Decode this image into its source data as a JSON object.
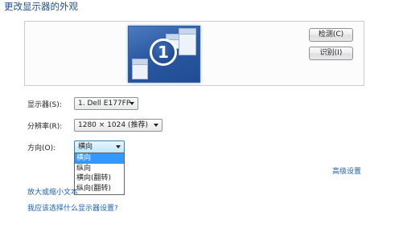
{
  "page": {
    "title": "更改显示器的外观"
  },
  "preview": {
    "monitor_number": "1",
    "detect_label": "检测(C)",
    "identify_label": "识别(I)"
  },
  "fields": {
    "display_label": "显示器(S):",
    "display_value": "1. Dell E177FP",
    "resolution_label": "分辨率(R):",
    "resolution_value": "1280 × 1024 (推荐)",
    "orientation_label": "方向(O):",
    "orientation_value": "横向"
  },
  "orientation_options": [
    {
      "label": "横向",
      "selected": true
    },
    {
      "label": "纵向",
      "selected": false
    },
    {
      "label": "横向(翻转)",
      "selected": false
    },
    {
      "label": "纵向(翻转)",
      "selected": false
    }
  ],
  "links": {
    "advanced_settings": "高级设置",
    "zoom_text": "放大或缩小文本",
    "which_display_settings": "我应该选择什么显示器设置?"
  },
  "colors": {
    "title": "#1e4d92",
    "link": "#1c5fb0",
    "selection": "#3399ff",
    "monitor_tile": "#2b5aa2"
  }
}
